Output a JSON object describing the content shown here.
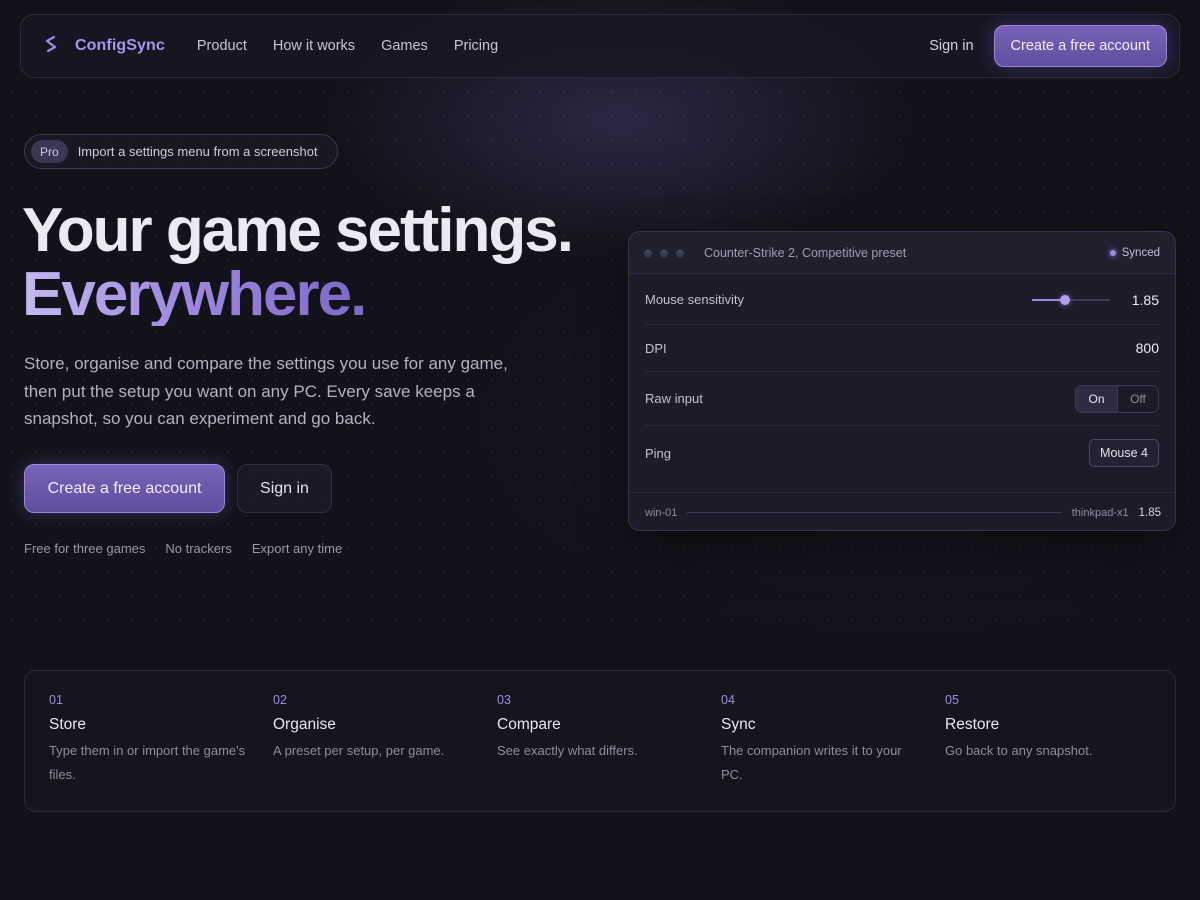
{
  "brand": {
    "name": "ConfigSync",
    "logo_icon": "configsync-logo-icon"
  },
  "nav": {
    "links": [
      "Product",
      "How it works",
      "Games",
      "Pricing"
    ],
    "sign_in": "Sign in",
    "cta": "Create a free account"
  },
  "promo": {
    "badge": "Pro",
    "text": "Import a settings menu from a screenshot"
  },
  "hero": {
    "headline": "Your game settings.",
    "headline_accent": "Everywhere.",
    "description": "Store, organise and compare the settings you use for any game, then put the setup you want on any PC. Every save keeps a snapshot, so you can experiment and go back.",
    "cta_primary": "Create a free account",
    "cta_secondary": "Sign in",
    "notes": [
      "Free for three games",
      "No trackers",
      "Export any time"
    ]
  },
  "preset_card": {
    "title": "Counter-Strike 2, Competitive preset",
    "status": "Synced",
    "rows": {
      "sensitivity": {
        "label": "Mouse sensitivity",
        "value": "1.85",
        "slider_fraction": 0.42
      },
      "dpi": {
        "label": "DPI",
        "value": "800"
      },
      "raw_input": {
        "label": "Raw input",
        "on": "On",
        "off": "Off",
        "selected": "On"
      },
      "ping": {
        "label": "Ping",
        "value": "Mouse 4"
      }
    },
    "footer": {
      "source": "win-01",
      "target": "thinkpad-x1",
      "value": "1.85"
    }
  },
  "steps": [
    {
      "num": "01",
      "title": "Store",
      "desc": "Type them in or import the game's files."
    },
    {
      "num": "02",
      "title": "Organise",
      "desc": "A preset per setup, per game."
    },
    {
      "num": "03",
      "title": "Compare",
      "desc": "See exactly what differs."
    },
    {
      "num": "04",
      "title": "Sync",
      "desc": "The companion writes it to your PC."
    },
    {
      "num": "05",
      "title": "Restore",
      "desc": "Go back to any snapshot."
    }
  ],
  "colors": {
    "accent": "#9f8ae0",
    "background": "#12121a",
    "button": "#6a58aa"
  }
}
